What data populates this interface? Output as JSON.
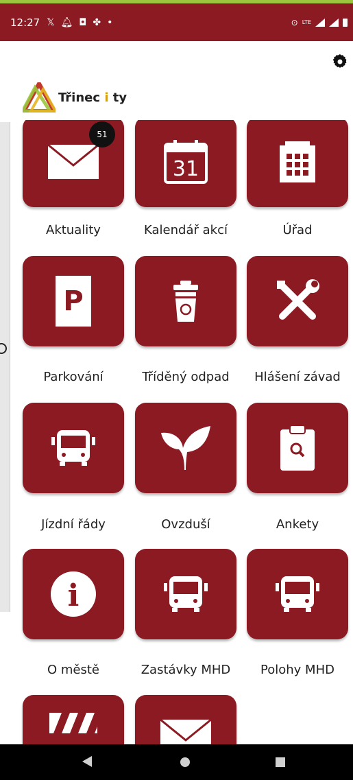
{
  "status_bar": {
    "time": "12:27",
    "left_icons": [
      "x-icon",
      "bell-icon",
      "instagram-icon",
      "fan-icon",
      "dot-icon"
    ],
    "right_icons": [
      "alarm-icon",
      "lte-icon",
      "signal-icon",
      "signal-icon",
      "battery-icon"
    ],
    "lte_text": "LTE"
  },
  "header": {
    "logo_text_main": "Třinec ",
    "logo_text_accent": "i",
    "logo_text_end": " ty",
    "settings_icon": "gear-icon"
  },
  "badge": "51",
  "tiles": [
    {
      "label": "Aktuality",
      "icon": "mail-icon"
    },
    {
      "label": "Kalendář akcí",
      "icon": "calendar-icon",
      "icon_text": "31"
    },
    {
      "label": "Úřad",
      "icon": "building-icon"
    },
    {
      "label": "Parkování",
      "icon": "parking-icon",
      "icon_text": "P"
    },
    {
      "label": "Tříděný odpad",
      "icon": "recycle-bin-icon"
    },
    {
      "label": "Hlášení závad",
      "icon": "tools-icon"
    },
    {
      "label": "Jízdní řády",
      "icon": "bus-icon"
    },
    {
      "label": "Ovzduší",
      "icon": "leaf-icon"
    },
    {
      "label": "Ankety",
      "icon": "clipboard-search-icon"
    },
    {
      "label": "O městě",
      "icon": "info-icon",
      "icon_text": "i"
    },
    {
      "label": "Zastávky MHD",
      "icon": "bus-icon"
    },
    {
      "label": "Polohy MHD",
      "icon": "bus-icon"
    },
    {
      "label": "",
      "icon": "barrier-icon"
    },
    {
      "label": "",
      "icon": "mail-icon"
    }
  ],
  "colors": {
    "brand": "#8b1a22",
    "accent_top": "#9bc53d",
    "logo_accent": "#d4a017"
  },
  "nav": {
    "back_icon": "back-triangle-icon",
    "home_icon": "home-circle-icon",
    "recent_icon": "recents-square-icon"
  }
}
